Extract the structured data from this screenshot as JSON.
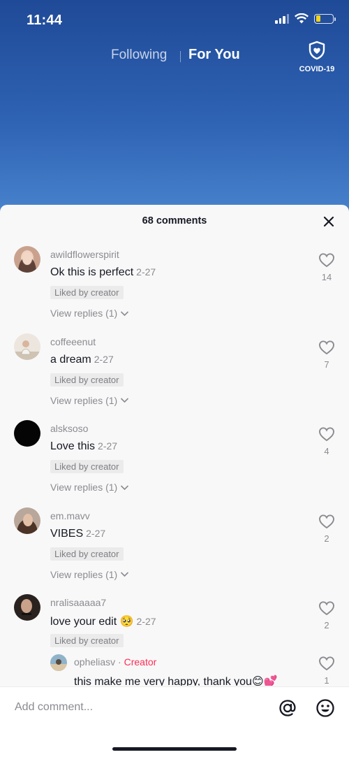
{
  "status_bar": {
    "time": "11:44"
  },
  "top_nav": {
    "following": "Following",
    "for_you": "For You",
    "covid_label": "COVID-19"
  },
  "comments_sheet": {
    "title": "68 comments",
    "comments": [
      {
        "username": "awildflowerspirit",
        "text": "Ok this is perfect",
        "date": "2-27",
        "badge": "Liked by creator",
        "view_replies": "View replies (1)",
        "likes": "14"
      },
      {
        "username": "coffeeenut",
        "text": "a dream",
        "date": "2-27",
        "badge": "Liked by creator",
        "view_replies": "View replies (1)",
        "likes": "7"
      },
      {
        "username": "alsksoso",
        "text": "Love this",
        "date": "2-27",
        "badge": "Liked by creator",
        "view_replies": "View replies (1)",
        "likes": "4"
      },
      {
        "username": "em.mavv",
        "text": "VIBES",
        "date": "2-27",
        "badge": "Liked by creator",
        "view_replies": "View replies (1)",
        "likes": "2"
      },
      {
        "username": "nralisaaaaa7",
        "text": "love your edit 🥺",
        "date": "2-27",
        "badge": "Liked by creator",
        "likes": "2"
      }
    ],
    "reply": {
      "username": "opheliasv",
      "separator": " · ",
      "creator_label": "Creator",
      "text": "this make me very happy, thank you😊💕",
      "likes": "1"
    }
  },
  "input_bar": {
    "placeholder": "Add comment..."
  },
  "colors": {
    "accent_creator": "#fe2c55",
    "badge_bg": "#ebebeb",
    "sheet_bg": "#f8f8f8"
  }
}
